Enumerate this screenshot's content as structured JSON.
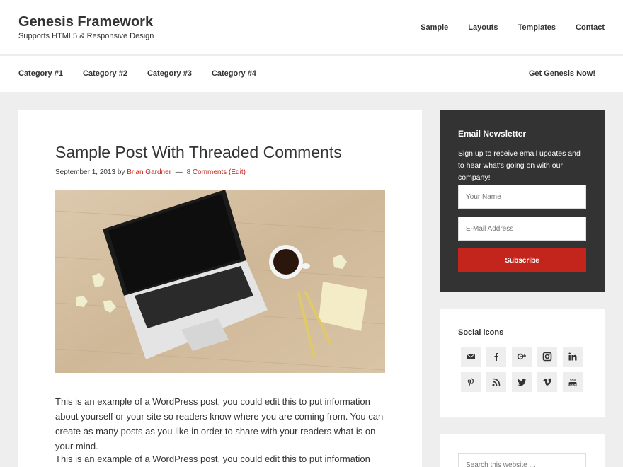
{
  "header": {
    "site_title": "Genesis Framework",
    "site_description": "Supports HTML5 & Responsive Design",
    "nav": [
      "Sample",
      "Layouts",
      "Templates",
      "Contact"
    ]
  },
  "category_nav": {
    "items": [
      "Category #1",
      "Category #2",
      "Category #3",
      "Category #4"
    ],
    "cta": "Get Genesis Now!"
  },
  "post": {
    "title": "Sample Post With Threaded Comments",
    "date": "September 1, 2013",
    "by": "by",
    "author": "Brian Gardner",
    "separator": "—",
    "comments": "8 Comments",
    "edit": "(Edit)",
    "paragraphs": [
      "This is an example of a WordPress post, you could edit this to put information about yourself or your site so readers know where you are coming from. You can create as many posts as you like in order to share with your readers what is on your mind.",
      "This is an example of a WordPress post, you could edit this to put information about"
    ]
  },
  "newsletter": {
    "title": "Email Newsletter",
    "text": "Sign up to receive email updates and to hear what's going on with our company!",
    "name_placeholder": "Your Name",
    "email_placeholder": "E-Mail Address",
    "button": "Subscribe"
  },
  "social": {
    "title": "Social icons",
    "icons": [
      "email-icon",
      "facebook-icon",
      "google-plus-icon",
      "instagram-icon",
      "linkedin-icon",
      "pinterest-icon",
      "rss-icon",
      "twitter-icon",
      "vimeo-icon",
      "youtube-icon"
    ]
  },
  "search": {
    "placeholder": "Search this website ..."
  },
  "colors": {
    "accent": "#c3251d",
    "dark": "#333333",
    "background": "#eeeeee"
  }
}
